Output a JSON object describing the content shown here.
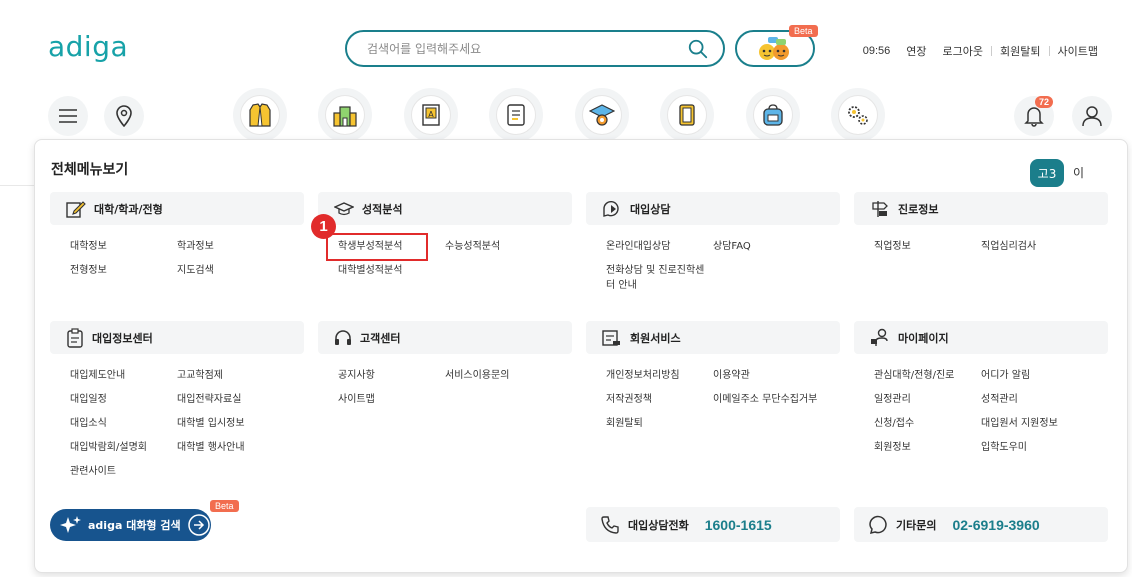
{
  "header": {
    "logo": "adiga",
    "search_placeholder": "검색어를 입력해주세요",
    "beta": "Beta",
    "time": "09:56",
    "extend": "연장",
    "logout": "로그아웃",
    "withdraw": "회원탈퇴",
    "sitemap": "사이트맵",
    "notification_count": "72"
  },
  "panel": {
    "title": "전체메뉴보기",
    "grade": "고3",
    "grade_suffix": "이",
    "step_number": "1",
    "sections": {
      "univ": {
        "title": "대학/학과/전형",
        "links": [
          "대학정보",
          "학과정보",
          "전형정보",
          "지도검색"
        ]
      },
      "grades": {
        "title": "성적분석",
        "links": [
          "학생부성적분석",
          "수능성적분석",
          "대학별성적분석"
        ]
      },
      "counsel": {
        "title": "대입상담",
        "links": [
          "온라인대입상담",
          "상담FAQ",
          "전화상담 및 진로진학센",
          "터 안내"
        ]
      },
      "career": {
        "title": "진로정보",
        "links": [
          "직업정보",
          "직업심리검사"
        ]
      },
      "info": {
        "title": "대입정보센터",
        "links": [
          "대입제도안내",
          "고교학점제",
          "대입일정",
          "대입전략자료실",
          "대입소식",
          "대학별 입시정보",
          "대입박람회/설명회",
          "대학별 행사안내",
          "관련사이트"
        ]
      },
      "support": {
        "title": "고객센터",
        "links": [
          "공지사항",
          "서비스이용문의",
          "사이트맵"
        ]
      },
      "member": {
        "title": "회원서비스",
        "links": [
          "개인정보처리방침",
          "이용약관",
          "저작권정책",
          "이메일주소 무단수집거부",
          "회원탈퇴"
        ]
      },
      "mypage": {
        "title": "마이페이지",
        "links": [
          "관심대학/전형/진로",
          "어디가 알림",
          "일정관리",
          "성적관리",
          "신청/접수",
          "대입원서 지원정보",
          "회원정보",
          "입학도우미"
        ]
      }
    },
    "ai_search": {
      "label": "adiga 대화형 검색",
      "beta": "Beta"
    },
    "phone": {
      "label": "대입상담전화",
      "number": "1600-1615"
    },
    "other": {
      "label": "기타문의",
      "number": "02-6919-3960"
    }
  },
  "colors": {
    "brand": "#1b7e8b",
    "accent": "#f26d4f",
    "highlight": "#e12b2b",
    "ai_button": "#17548e"
  },
  "icons": [
    "search-icon",
    "chatbot-icon",
    "hamburger-icon",
    "location-pin-icon",
    "uniform-icon",
    "building-icon",
    "dictionary-icon",
    "report-icon",
    "graduation-cap-icon",
    "notebook-icon",
    "backpack-icon",
    "gears-icon",
    "bell-icon",
    "user-icon",
    "pencil-note-icon",
    "grad-hat-icon",
    "chat-bubble-icon",
    "signpost-icon",
    "clipboard-icon",
    "headset-icon",
    "member-card-icon",
    "person-key-icon",
    "sparkle-icon",
    "arrow-right-circle-icon",
    "phone-icon",
    "chat-question-icon"
  ]
}
